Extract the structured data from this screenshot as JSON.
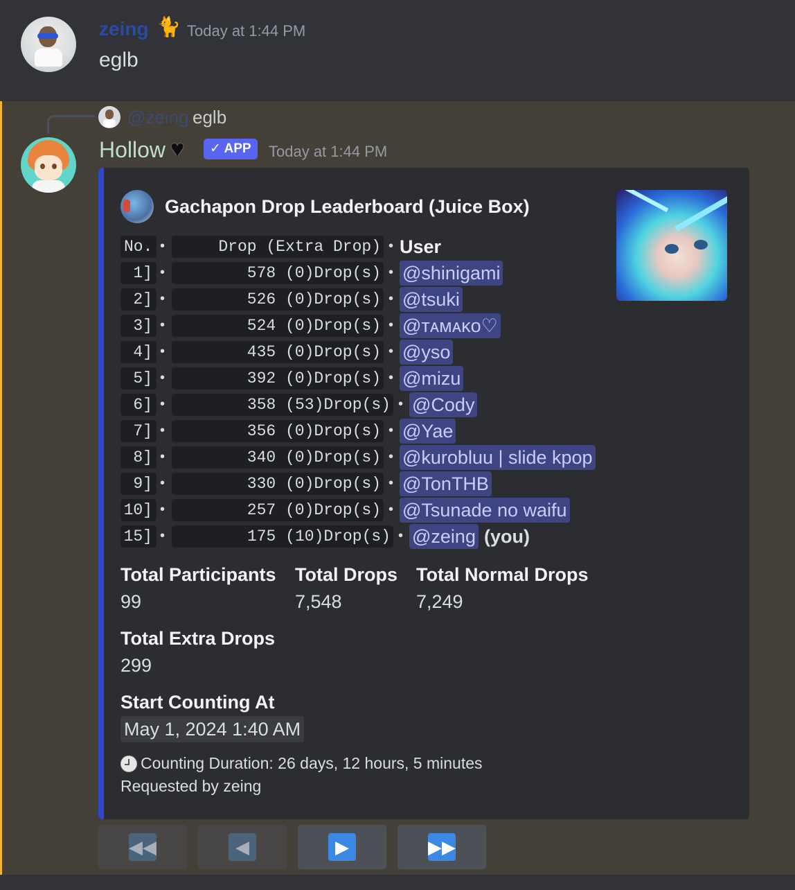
{
  "message1": {
    "username": "zeing",
    "timestamp": "Today at 1:44 PM",
    "text": "eglb",
    "deco_icon": "black-cat-icon"
  },
  "message2": {
    "reply": {
      "username": "@zeing",
      "text": "eglb"
    },
    "username": "Hollow",
    "badge": "APP",
    "timestamp": "Today at 1:44 PM",
    "accent_color": "#f0b232",
    "embed": {
      "bar_color": "#2f48c7",
      "author": "Gachapon Drop Leaderboard (Juice Box)",
      "header": {
        "no": "No.",
        "drop": "Drop (Extra Drop)",
        "user": "User"
      },
      "rows": [
        {
          "no": "1]",
          "drop": "578 (0)Drop(s)",
          "user": "@shinigami"
        },
        {
          "no": "2]",
          "drop": "526 (0)Drop(s)",
          "user": "@tsuki"
        },
        {
          "no": "3]",
          "drop": "524 (0)Drop(s)",
          "user": "@ᴛᴀᴍᴀᴋᴏ♡"
        },
        {
          "no": "4]",
          "drop": "435 (0)Drop(s)",
          "user": "@yso"
        },
        {
          "no": "5]",
          "drop": "392 (0)Drop(s)",
          "user": "@mizu"
        },
        {
          "no": "6]",
          "drop": "358 (53)Drop(s)",
          "user": "@Cody"
        },
        {
          "no": "7]",
          "drop": "356 (0)Drop(s)",
          "user": "@Yae"
        },
        {
          "no": "8]",
          "drop": "340 (0)Drop(s)",
          "user": "@kurobluu | slide kpop"
        },
        {
          "no": "9]",
          "drop": "330 (0)Drop(s)",
          "user": "@TonTHB"
        },
        {
          "no": "10]",
          "drop": "257 (0)Drop(s)",
          "user": "@Tsunade no waifu"
        },
        {
          "no": "15]",
          "drop": "175 (10)Drop(s)",
          "user": "@zeing",
          "suffix": "(you)"
        }
      ],
      "fields": {
        "total_participants": {
          "name": "Total Participants",
          "value": "99"
        },
        "total_drops": {
          "name": "Total Drops",
          "value": "7,548"
        },
        "total_normal_drops": {
          "name": "Total Normal Drops",
          "value": "7,249"
        },
        "total_extra_drops": {
          "name": "Total Extra Drops",
          "value": "299"
        },
        "start_counting_at": {
          "name": "Start Counting At",
          "value": "May 1, 2024 1:40 AM"
        }
      },
      "footer": {
        "icon": "clock-icon",
        "duration": "Counting Duration: 26 days, 12 hours, 5 minutes",
        "requested_by": "Requested by zeing"
      }
    },
    "buttons": [
      {
        "name": "first-page-button",
        "icon": "double-left-arrow-icon",
        "glyph": "◀◀",
        "disabled": true
      },
      {
        "name": "prev-page-button",
        "icon": "left-arrow-icon",
        "glyph": "◀",
        "disabled": true
      },
      {
        "name": "next-page-button",
        "icon": "right-arrow-icon",
        "glyph": "▶",
        "disabled": false
      },
      {
        "name": "last-page-button",
        "icon": "double-right-arrow-icon",
        "glyph": "▶▶",
        "disabled": false
      }
    ]
  }
}
